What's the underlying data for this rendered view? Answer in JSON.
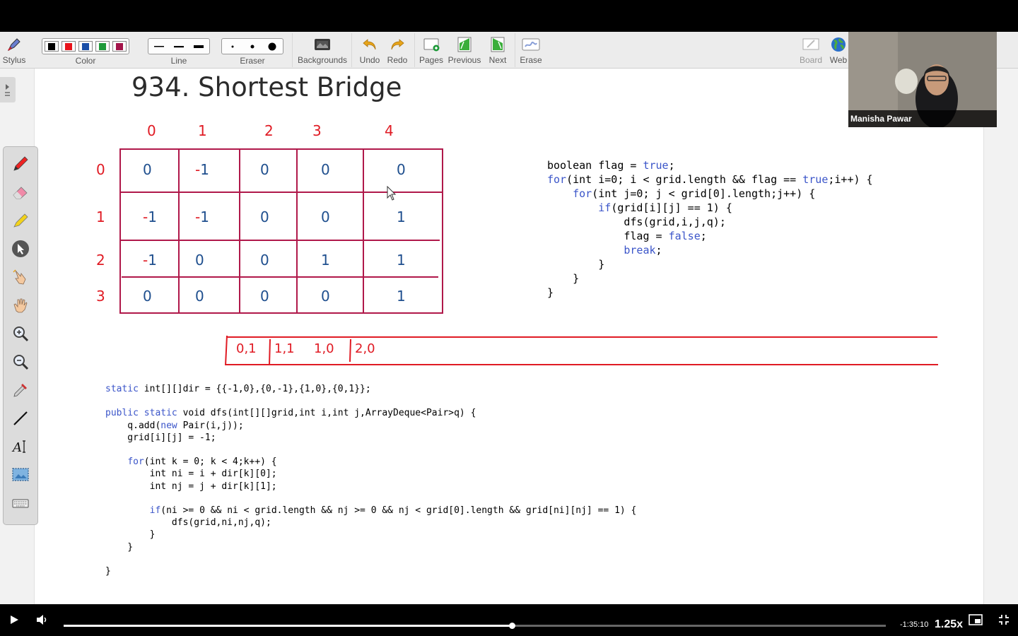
{
  "toolbar": {
    "stylus": "Stylus",
    "color": "Color",
    "line": "Line",
    "eraser": "Eraser",
    "backgrounds": "Backgrounds",
    "undo": "Undo",
    "redo": "Redo",
    "pages": "Pages",
    "previous": "Previous",
    "next": "Next",
    "erase": "Erase",
    "board": "Board",
    "web": "Web",
    "colors": [
      "#000000",
      "#e8141c",
      "#1a4fa8",
      "#1f9a3a",
      "#a3144a"
    ]
  },
  "whiteboard": {
    "title": "934. Shortest Bridge",
    "col_headers": [
      "0",
      "1",
      "2",
      "3",
      "4"
    ],
    "row_headers": [
      "0",
      "1",
      "2",
      "3"
    ],
    "grid": [
      [
        "0",
        "-1",
        "0",
        "0",
        "0"
      ],
      [
        "-1",
        "-1",
        "0",
        "0",
        "1"
      ],
      [
        "-1",
        "0",
        "0",
        "1",
        "1"
      ],
      [
        "0",
        "0",
        "0",
        "0",
        "1"
      ]
    ],
    "queue": [
      "0,1",
      "1,1",
      "1,0",
      "2,0"
    ],
    "code_main": [
      "boolean flag = true;",
      "for(int i=0; i < grid.length && flag == true;i++) {",
      "    for(int j=0; j < grid[0].length;j++) {",
      "        if(grid[i][j] == 1) {",
      "            dfs(grid,i,j,q);",
      "            flag = false;",
      "            break;",
      "        }",
      "    }",
      "}"
    ],
    "code_dfs": [
      "static int[][]dir = {{-1,0},{0,-1},{1,0},{0,1}};",
      "",
      "public static void dfs(int[][]grid,int i,int j,ArrayDeque<Pair>q) {",
      "    q.add(new Pair(i,j));",
      "    grid[i][j] = -1;",
      "",
      "    for(int k = 0; k < 4;k++) {",
      "        int ni = i + dir[k][0];",
      "        int nj = j + dir[k][1];",
      "",
      "        if(ni >= 0 && ni < grid.length && nj >= 0 && nj < grid[0].length && grid[ni][nj] == 1) {",
      "            dfs(grid,ni,nj,q);",
      "        }",
      "    }",
      "",
      "}"
    ]
  },
  "video": {
    "participant_name": "Manisha Pawar"
  },
  "player": {
    "time_remaining": "-1:35:10",
    "speed": "1.25x",
    "progress": 0.545
  }
}
